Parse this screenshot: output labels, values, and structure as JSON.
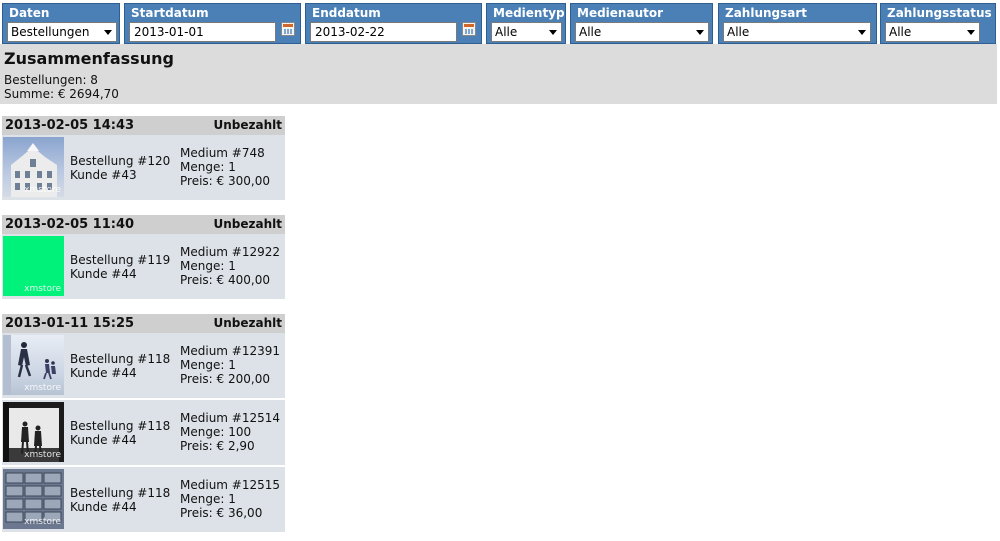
{
  "filters": [
    {
      "label": "Daten",
      "type": "select",
      "value": "Bestellungen"
    },
    {
      "label": "Startdatum",
      "type": "date",
      "value": "2013-01-01"
    },
    {
      "label": "Enddatum",
      "type": "date",
      "value": "2013-02-22"
    },
    {
      "label": "Medientyp",
      "type": "select",
      "value": "Alle"
    },
    {
      "label": "Medienautor",
      "type": "select",
      "value": "Alle"
    },
    {
      "label": "Zahlungsart",
      "type": "select",
      "value": "Alle"
    },
    {
      "label": "Zahlungsstatus",
      "type": "select",
      "value": "Alle"
    }
  ],
  "summary": {
    "title": "Zusammenfassung",
    "orders_line": "Bestellungen: 8",
    "sum_line": "Summe: € 2694,70"
  },
  "orders": [
    {
      "date": "2013-02-05 14:43",
      "status": "Unbezahlt",
      "items": [
        {
          "order": "Bestellung #120",
          "customer": "Kunde #43",
          "medium": "Medium #748",
          "qty": "Menge: 1",
          "price": "Preis: € 300,00",
          "thumb": "building",
          "watermark": "xmstore"
        }
      ]
    },
    {
      "date": "2013-02-05 11:40",
      "status": "Unbezahlt",
      "items": [
        {
          "order": "Bestellung #119",
          "customer": "Kunde #44",
          "medium": "Medium #12922",
          "qty": "Menge: 1",
          "price": "Preis: € 400,00",
          "thumb": "green",
          "watermark": "xmstore"
        }
      ]
    },
    {
      "date": "2013-01-11 15:25",
      "status": "Unbezahlt",
      "items": [
        {
          "order": "Bestellung #118",
          "customer": "Kunde #44",
          "medium": "Medium #12391",
          "qty": "Menge: 1",
          "price": "Preis: € 200,00",
          "thumb": "people",
          "watermark": "xmstore"
        },
        {
          "order": "Bestellung #118",
          "customer": "Kunde #44",
          "medium": "Medium #12514",
          "qty": "Menge: 100",
          "price": "Preis: € 2,90",
          "thumb": "office",
          "watermark": "xmstore"
        },
        {
          "order": "Bestellung #118",
          "customer": "Kunde #44",
          "medium": "Medium #12515",
          "qty": "Menge: 1",
          "price": "Preis: € 36,00",
          "thumb": "mailboxes",
          "watermark": "xmstore"
        }
      ]
    }
  ],
  "colors": {
    "filter_bg": "#4a80b6",
    "summary_bg": "#dcdcdc",
    "card_head_bg": "#cfcfcf",
    "row_bg": "#dde2e8"
  }
}
